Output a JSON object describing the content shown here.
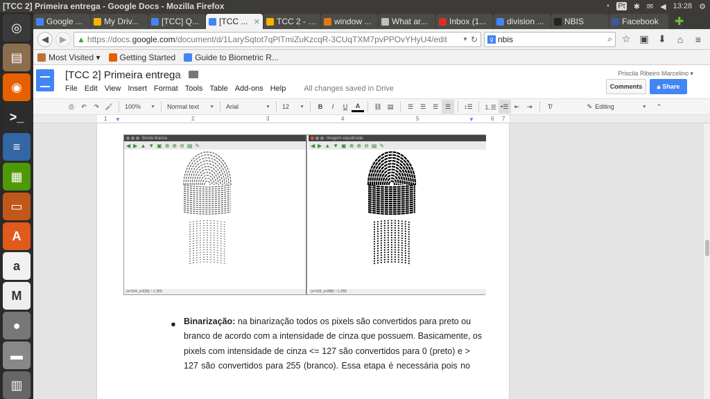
{
  "system": {
    "window_title": "[TCC 2] Primeira entrega - Google Docs - Mozilla Firefox",
    "clock": "13:28",
    "tray": [
      "wifi-icon",
      "keyboard-icon",
      "bluetooth-icon",
      "mail-icon",
      "volume-icon",
      "settings-icon"
    ],
    "keyboard_label": "Pt"
  },
  "launcher": {
    "items": [
      {
        "name": "ubuntu-dash-icon",
        "glyph": "◎",
        "color": "#3a3a3a"
      },
      {
        "name": "files-icon",
        "glyph": "▤",
        "color": "#8c6d4e"
      },
      {
        "name": "firefox-icon",
        "glyph": "◉",
        "color": "#e66000"
      },
      {
        "name": "terminal-icon",
        "glyph": ">_",
        "color": "#2c2c2c"
      },
      {
        "name": "writer-icon",
        "glyph": "≡",
        "color": "#3465a4"
      },
      {
        "name": "calc-icon",
        "glyph": "▦",
        "color": "#4e9a06"
      },
      {
        "name": "impress-icon",
        "glyph": "▭",
        "color": "#c2571a"
      },
      {
        "name": "software-center-icon",
        "glyph": "A",
        "color": "#e05a1c"
      },
      {
        "name": "amazon-icon",
        "glyph": "a",
        "color": "#f1f1f1"
      },
      {
        "name": "gmail-icon",
        "glyph": "M",
        "color": "#eeeeee"
      },
      {
        "name": "drive-icon",
        "glyph": "●",
        "color": "#777777"
      },
      {
        "name": "drive-stack-icon",
        "glyph": "▬",
        "color": "#888888"
      },
      {
        "name": "workspace-icon",
        "glyph": "▥",
        "color": "#666666"
      }
    ]
  },
  "tabs": [
    {
      "label": "Google ...",
      "color": "#4285f4",
      "active": false
    },
    {
      "label": "My Driv...",
      "color": "#f4b400",
      "active": false
    },
    {
      "label": "[TCC] Q...",
      "color": "#4285f4",
      "active": false
    },
    {
      "label": "[TCC ...",
      "color": "#4285f4",
      "active": true
    },
    {
      "label": "TCC 2 - P...",
      "color": "#f4b400",
      "active": false
    },
    {
      "label": "window ...",
      "color": "#e07a10",
      "active": false
    },
    {
      "label": "What ar...",
      "color": "#bfbfbf",
      "active": false
    },
    {
      "label": "Inbox (1...",
      "color": "#d93025",
      "active": false
    },
    {
      "label": "division ...",
      "color": "#4285f4",
      "active": false
    },
    {
      "label": "NBIS",
      "color": "#222222",
      "active": false
    },
    {
      "label": "Facebook",
      "color": "#3b5998",
      "active": false
    }
  ],
  "nav": {
    "url_prefix": "https://docs.",
    "url_domain": "google.com",
    "url_path": "/document/d/1LarySqtot7qPlTmiZuKzcqR-3CUqTXM7pvPPOvYHyU4/edit",
    "search_value": "nbis"
  },
  "bookmarks": [
    {
      "label": "Most Visited ▾",
      "color": "#c07030"
    },
    {
      "label": "Getting Started",
      "color": "#e66000"
    },
    {
      "label": "Guide to Biometric R...",
      "color": "#4285f4"
    }
  ],
  "doc": {
    "title": "[TCC 2] Primeira entrega",
    "menus": [
      "File",
      "Edit",
      "View",
      "Insert",
      "Format",
      "Tools",
      "Table",
      "Add-ons",
      "Help"
    ],
    "saved_status": "All changes saved in Drive",
    "user": "Priscila Ribeiro Marcelino ▾",
    "comments_label": "Comments",
    "share_label": "Share"
  },
  "toolbar": {
    "zoom": "100%",
    "style": "Normal text",
    "font": "Arial",
    "size": "12",
    "bold": "B",
    "italic": "I",
    "underline": "U",
    "text_color": "A",
    "mode": "Editing"
  },
  "ruler": {
    "numbers": [
      "1",
      "1",
      "2",
      "3",
      "4",
      "5",
      "6",
      "7"
    ]
  },
  "figure": {
    "left_title": "Borda branca",
    "right_title": "Imagem equalizada",
    "left_status": "(x=314, y=229) ~ L:255",
    "right_status": "(x=103, y=288) ~ L:255"
  },
  "body": {
    "heading": "Binarização:",
    "line1_rest": " na binarização todos os pixels são convertidos para preto ou",
    "line2": "branco de acordo com a intensidade de cinza que possuem. Basicamente, os",
    "line3": "pixels com intensidade de cinza <= 127 são convertidos para 0 (preto) e >",
    "line4": "127 são convertidos para 255 (branco). Essa etapa é necessária pois no"
  }
}
